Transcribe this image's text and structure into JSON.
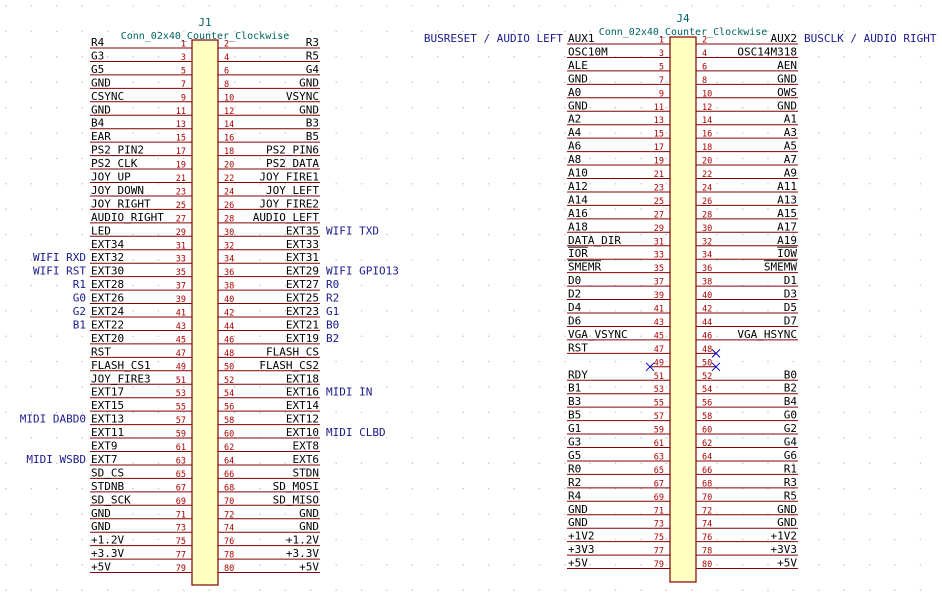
{
  "colors": {
    "background": "#ffffff",
    "grid_dot": "#c8c8c8",
    "wire": "#840000",
    "body_outline": "#840000",
    "body_fill": "#ffffc2",
    "pin_number": "#a90000",
    "net_label": "#000000",
    "global_label": "#1a1a8c",
    "reference": "#006464",
    "no_connect": "#0000c8"
  },
  "j1": {
    "reference": "J1",
    "value": "Conn_02x40_Counter_Clockwise",
    "pins": [
      {
        "n": "1",
        "net": "R4",
        "side": "left"
      },
      {
        "n": "2",
        "net": "R3",
        "side": "right"
      },
      {
        "n": "3",
        "net": "G3",
        "side": "left"
      },
      {
        "n": "4",
        "net": "R5",
        "side": "right"
      },
      {
        "n": "5",
        "net": "G5",
        "side": "left"
      },
      {
        "n": "6",
        "net": "G4",
        "side": "right"
      },
      {
        "n": "7",
        "net": "GND",
        "side": "left"
      },
      {
        "n": "8",
        "net": "GND",
        "side": "right"
      },
      {
        "n": "9",
        "net": "CSYNC",
        "side": "left"
      },
      {
        "n": "10",
        "net": "VSYNC",
        "side": "right"
      },
      {
        "n": "11",
        "net": "GND",
        "side": "left"
      },
      {
        "n": "12",
        "net": "GND",
        "side": "right"
      },
      {
        "n": "13",
        "net": "B4",
        "side": "left"
      },
      {
        "n": "14",
        "net": "B3",
        "side": "right"
      },
      {
        "n": "15",
        "net": "EAR",
        "side": "left"
      },
      {
        "n": "16",
        "net": "B5",
        "side": "right"
      },
      {
        "n": "17",
        "net": "PS2_PIN2",
        "side": "left"
      },
      {
        "n": "18",
        "net": "PS2_PIN6",
        "side": "right"
      },
      {
        "n": "19",
        "net": "PS2_CLK",
        "side": "left"
      },
      {
        "n": "20",
        "net": "PS2_DATA",
        "side": "right"
      },
      {
        "n": "21",
        "net": "JOY_UP",
        "side": "left"
      },
      {
        "n": "22",
        "net": "JOY_FIRE1",
        "side": "right"
      },
      {
        "n": "23",
        "net": "JOY_DOWN",
        "side": "left"
      },
      {
        "n": "24",
        "net": "JOY_LEFT",
        "side": "right"
      },
      {
        "n": "25",
        "net": "JOY_RIGHT",
        "side": "left"
      },
      {
        "n": "26",
        "net": "JOY_FIRE2",
        "side": "right"
      },
      {
        "n": "27",
        "net": "AUDIO_RIGHT",
        "side": "left"
      },
      {
        "n": "28",
        "net": "AUDIO_LEFT",
        "side": "right"
      },
      {
        "n": "29",
        "net": "LED",
        "side": "left"
      },
      {
        "n": "30",
        "net": "EXT35",
        "side": "right"
      },
      {
        "n": "31",
        "net": "EXT34",
        "side": "left"
      },
      {
        "n": "32",
        "net": "EXT33",
        "side": "right"
      },
      {
        "n": "33",
        "net": "EXT32",
        "side": "left"
      },
      {
        "n": "34",
        "net": "EXT31",
        "side": "right"
      },
      {
        "n": "35",
        "net": "EXT30",
        "side": "left"
      },
      {
        "n": "36",
        "net": "EXT29",
        "side": "right"
      },
      {
        "n": "37",
        "net": "EXT28",
        "side": "left"
      },
      {
        "n": "38",
        "net": "EXT27",
        "side": "right"
      },
      {
        "n": "39",
        "net": "EXT26",
        "side": "left"
      },
      {
        "n": "40",
        "net": "EXT25",
        "side": "right"
      },
      {
        "n": "41",
        "net": "EXT24",
        "side": "left"
      },
      {
        "n": "42",
        "net": "EXT23",
        "side": "right"
      },
      {
        "n": "43",
        "net": "EXT22",
        "side": "left"
      },
      {
        "n": "44",
        "net": "EXT21",
        "side": "right"
      },
      {
        "n": "45",
        "net": "EXT20",
        "side": "left"
      },
      {
        "n": "46",
        "net": "EXT19",
        "side": "right"
      },
      {
        "n": "47",
        "net": "RST",
        "side": "left"
      },
      {
        "n": "48",
        "net": "FLASH_CS",
        "side": "right"
      },
      {
        "n": "49",
        "net": "FLASH_CS1",
        "side": "left"
      },
      {
        "n": "50",
        "net": "FLASH_CS2",
        "side": "right"
      },
      {
        "n": "51",
        "net": "JOY_FIRE3",
        "side": "left"
      },
      {
        "n": "52",
        "net": "EXT18",
        "side": "right"
      },
      {
        "n": "53",
        "net": "EXT17",
        "side": "left"
      },
      {
        "n": "54",
        "net": "EXT16",
        "side": "right"
      },
      {
        "n": "55",
        "net": "EXT15",
        "side": "left"
      },
      {
        "n": "56",
        "net": "EXT14",
        "side": "right"
      },
      {
        "n": "57",
        "net": "EXT13",
        "side": "left"
      },
      {
        "n": "58",
        "net": "EXT12",
        "side": "right"
      },
      {
        "n": "59",
        "net": "EXT11",
        "side": "left"
      },
      {
        "n": "60",
        "net": "EXT10",
        "side": "right"
      },
      {
        "n": "61",
        "net": "EXT9",
        "side": "left"
      },
      {
        "n": "62",
        "net": "EXT8",
        "side": "right"
      },
      {
        "n": "63",
        "net": "EXT7",
        "side": "left"
      },
      {
        "n": "64",
        "net": "EXT6",
        "side": "right"
      },
      {
        "n": "65",
        "net": "SD_CS",
        "side": "left"
      },
      {
        "n": "66",
        "net": "STDN",
        "side": "right"
      },
      {
        "n": "67",
        "net": "STDNB",
        "side": "left"
      },
      {
        "n": "68",
        "net": "SD_MOSI",
        "side": "right"
      },
      {
        "n": "69",
        "net": "SD_SCK",
        "side": "left"
      },
      {
        "n": "70",
        "net": "SD_MISO",
        "side": "right"
      },
      {
        "n": "71",
        "net": "GND",
        "side": "left"
      },
      {
        "n": "72",
        "net": "GND",
        "side": "right"
      },
      {
        "n": "73",
        "net": "GND",
        "side": "left"
      },
      {
        "n": "74",
        "net": "GND",
        "side": "right"
      },
      {
        "n": "75",
        "net": "+1.2V",
        "side": "left"
      },
      {
        "n": "76",
        "net": "+1.2V",
        "side": "right"
      },
      {
        "n": "77",
        "net": "+3.3V",
        "side": "left"
      },
      {
        "n": "78",
        "net": "+3.3V",
        "side": "right"
      },
      {
        "n": "79",
        "net": "+5V",
        "side": "left"
      },
      {
        "n": "80",
        "net": "+5V",
        "side": "right"
      }
    ],
    "global_labels": [
      {
        "pin": "30",
        "text": "WIFI TXD"
      },
      {
        "pin": "33",
        "text": "WIFI RXD"
      },
      {
        "pin": "35",
        "text": "WIFI RST"
      },
      {
        "pin": "36",
        "text": "WIFI GPIO13"
      },
      {
        "pin": "37",
        "text": "R1"
      },
      {
        "pin": "38",
        "text": "R0"
      },
      {
        "pin": "39",
        "text": "G0"
      },
      {
        "pin": "40",
        "text": "R2"
      },
      {
        "pin": "41",
        "text": "G2"
      },
      {
        "pin": "42",
        "text": "G1"
      },
      {
        "pin": "43",
        "text": "B1"
      },
      {
        "pin": "44",
        "text": "B0"
      },
      {
        "pin": "46",
        "text": "B2"
      },
      {
        "pin": "54",
        "text": "MIDI IN"
      },
      {
        "pin": "57",
        "text": "MIDI DABD0"
      },
      {
        "pin": "60",
        "text": "MIDI CLBD"
      },
      {
        "pin": "63",
        "text": "MIDI WSBD"
      }
    ]
  },
  "j4": {
    "reference": "J4",
    "value": "Conn_02x40_Counter_Clockwise",
    "pins": [
      {
        "n": "1",
        "net": "AUX1",
        "side": "left"
      },
      {
        "n": "2",
        "net": "AUX2",
        "side": "right"
      },
      {
        "n": "3",
        "net": "OSC10M",
        "side": "left"
      },
      {
        "n": "4",
        "net": "OSC14M318",
        "side": "right"
      },
      {
        "n": "5",
        "net": "ALE",
        "side": "left"
      },
      {
        "n": "6",
        "net": "AEN",
        "side": "right"
      },
      {
        "n": "7",
        "net": "GND",
        "side": "left"
      },
      {
        "n": "8",
        "net": "GND",
        "side": "right"
      },
      {
        "n": "9",
        "net": "A0",
        "side": "left"
      },
      {
        "n": "10",
        "net": "OWS",
        "side": "right"
      },
      {
        "n": "11",
        "net": "GND",
        "side": "left"
      },
      {
        "n": "12",
        "net": "GND",
        "side": "right"
      },
      {
        "n": "13",
        "net": "A2",
        "side": "left"
      },
      {
        "n": "14",
        "net": "A1",
        "side": "right"
      },
      {
        "n": "15",
        "net": "A4",
        "side": "left"
      },
      {
        "n": "16",
        "net": "A3",
        "side": "right"
      },
      {
        "n": "17",
        "net": "A6",
        "side": "left"
      },
      {
        "n": "18",
        "net": "A5",
        "side": "right"
      },
      {
        "n": "19",
        "net": "A8",
        "side": "left"
      },
      {
        "n": "20",
        "net": "A7",
        "side": "right"
      },
      {
        "n": "21",
        "net": "A10",
        "side": "left"
      },
      {
        "n": "22",
        "net": "A9",
        "side": "right"
      },
      {
        "n": "23",
        "net": "A12",
        "side": "left"
      },
      {
        "n": "24",
        "net": "A11",
        "side": "right"
      },
      {
        "n": "25",
        "net": "A14",
        "side": "left"
      },
      {
        "n": "26",
        "net": "A13",
        "side": "right"
      },
      {
        "n": "27",
        "net": "A16",
        "side": "left"
      },
      {
        "n": "28",
        "net": "A15",
        "side": "right"
      },
      {
        "n": "29",
        "net": "A18",
        "side": "left"
      },
      {
        "n": "30",
        "net": "A17",
        "side": "right"
      },
      {
        "n": "31",
        "net": "DATA_DIR",
        "side": "left"
      },
      {
        "n": "32",
        "net": "A19",
        "side": "right"
      },
      {
        "n": "33",
        "net": "IOR",
        "side": "left",
        "overbar": true
      },
      {
        "n": "34",
        "net": "IOW",
        "side": "right",
        "overbar": true
      },
      {
        "n": "35",
        "net": "SMEMR",
        "side": "left",
        "overbar": true
      },
      {
        "n": "36",
        "net": "SMEMW",
        "side": "right",
        "overbar": true
      },
      {
        "n": "37",
        "net": "D0",
        "side": "left"
      },
      {
        "n": "38",
        "net": "D1",
        "side": "right"
      },
      {
        "n": "39",
        "net": "D2",
        "side": "left"
      },
      {
        "n": "40",
        "net": "D3",
        "side": "right"
      },
      {
        "n": "41",
        "net": "D4",
        "side": "left"
      },
      {
        "n": "42",
        "net": "D5",
        "side": "right"
      },
      {
        "n": "43",
        "net": "D6",
        "side": "left"
      },
      {
        "n": "44",
        "net": "D7",
        "side": "right"
      },
      {
        "n": "45",
        "net": "VGA_VSYNC",
        "side": "left"
      },
      {
        "n": "46",
        "net": "VGA_HSYNC",
        "side": "right"
      },
      {
        "n": "47",
        "net": "RST",
        "side": "left"
      },
      {
        "n": "48",
        "net": "",
        "side": "right",
        "nc": true
      },
      {
        "n": "49",
        "net": "",
        "side": "left",
        "nc": true
      },
      {
        "n": "50",
        "net": "",
        "side": "right",
        "nc": true
      },
      {
        "n": "51",
        "net": "RDY",
        "side": "left"
      },
      {
        "n": "52",
        "net": "B0",
        "side": "right"
      },
      {
        "n": "53",
        "net": "B1",
        "side": "left"
      },
      {
        "n": "54",
        "net": "B2",
        "side": "right"
      },
      {
        "n": "55",
        "net": "B3",
        "side": "left"
      },
      {
        "n": "56",
        "net": "B4",
        "side": "right"
      },
      {
        "n": "57",
        "net": "B5",
        "side": "left"
      },
      {
        "n": "58",
        "net": "G0",
        "side": "right"
      },
      {
        "n": "59",
        "net": "G1",
        "side": "left"
      },
      {
        "n": "60",
        "net": "G2",
        "side": "right"
      },
      {
        "n": "61",
        "net": "G3",
        "side": "left"
      },
      {
        "n": "62",
        "net": "G4",
        "side": "right"
      },
      {
        "n": "63",
        "net": "G5",
        "side": "left"
      },
      {
        "n": "64",
        "net": "G6",
        "side": "right"
      },
      {
        "n": "65",
        "net": "R0",
        "side": "left"
      },
      {
        "n": "66",
        "net": "R1",
        "side": "right"
      },
      {
        "n": "67",
        "net": "R2",
        "side": "left"
      },
      {
        "n": "68",
        "net": "R3",
        "side": "right"
      },
      {
        "n": "69",
        "net": "R4",
        "side": "left"
      },
      {
        "n": "70",
        "net": "R5",
        "side": "right"
      },
      {
        "n": "71",
        "net": "GND",
        "side": "left"
      },
      {
        "n": "72",
        "net": "GND",
        "side": "right"
      },
      {
        "n": "73",
        "net": "GND",
        "side": "left"
      },
      {
        "n": "74",
        "net": "GND",
        "side": "right"
      },
      {
        "n": "75",
        "net": "+1V2",
        "side": "left"
      },
      {
        "n": "76",
        "net": "+1V2",
        "side": "right"
      },
      {
        "n": "77",
        "net": "+3V3",
        "side": "left"
      },
      {
        "n": "78",
        "net": "+3V3",
        "side": "right"
      },
      {
        "n": "79",
        "net": "+5V",
        "side": "left"
      },
      {
        "n": "80",
        "net": "+5V",
        "side": "right"
      }
    ],
    "global_labels": [
      {
        "pin": "1",
        "text": "BUSRESET / AUDIO LEFT"
      },
      {
        "pin": "2",
        "text": "BUSCLK / AUDIO RIGHT"
      }
    ]
  }
}
